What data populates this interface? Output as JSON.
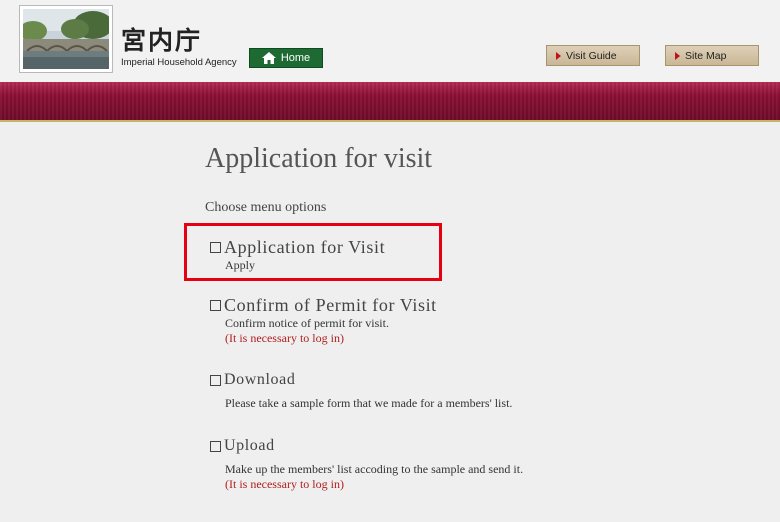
{
  "header": {
    "logo_kanji": "宮内庁",
    "logo_en": "Imperial Household Agency",
    "logo_photo": "imperial-palace-bridge-photo",
    "home_label": "Home",
    "nav": [
      {
        "label": "Visit Guide"
      },
      {
        "label": "Site Map"
      }
    ],
    "band_color": "#8a0f35",
    "accent_green": "#1d6b32"
  },
  "main": {
    "title": "Application for visit",
    "subtitle": "Choose menu options",
    "items": [
      {
        "label": "Application for Visit",
        "desc": "Apply",
        "note": ""
      },
      {
        "label": "Confirm of Permit for Visit",
        "desc": "Confirm notice of permit for visit.",
        "note": "(It is necessary to log in)"
      },
      {
        "label": " Download",
        "desc": "Please take a sample form that we made for a members' list.",
        "note": ""
      },
      {
        "label": " Upload",
        "desc": "Make up the members' list accoding to the sample and send it.",
        "note": "(It is necessary to log in)"
      }
    ],
    "highlight_color": "#e60012"
  }
}
